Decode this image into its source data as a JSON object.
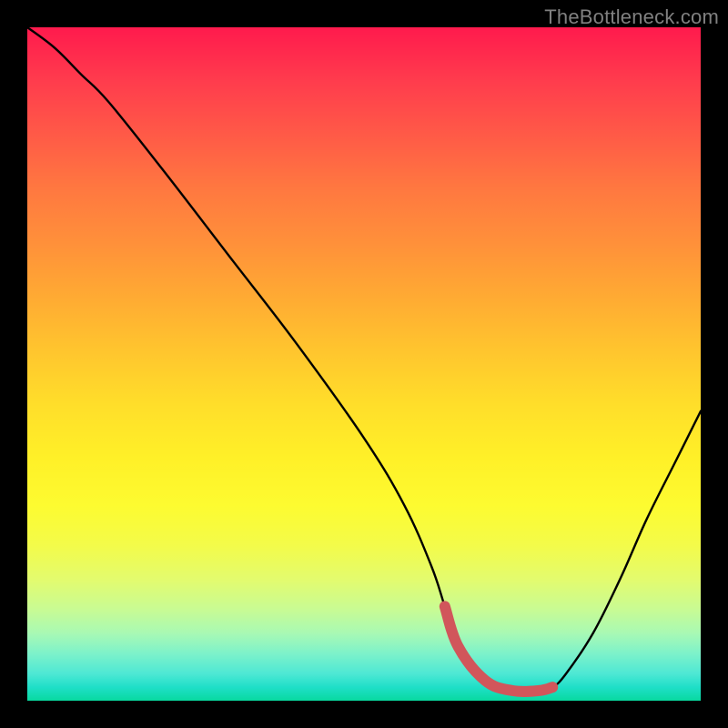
{
  "watermark": "TheBottleneck.com",
  "chart_data": {
    "type": "line",
    "title": "",
    "xlabel": "",
    "ylabel": "",
    "xlim": [
      0,
      100
    ],
    "ylim": [
      0,
      100
    ],
    "series": [
      {
        "name": "bottleneck-curve",
        "color": "#000000",
        "x": [
          0,
          4,
          8,
          12,
          20,
          30,
          40,
          50,
          56,
          60,
          62,
          64,
          68,
          72,
          76,
          78,
          80,
          84,
          88,
          92,
          96,
          100
        ],
        "values": [
          100,
          97,
          93,
          89,
          79,
          66,
          53,
          39,
          29,
          20,
          14,
          8,
          3,
          1.5,
          1.5,
          2,
          4,
          10,
          18,
          27,
          35,
          43
        ]
      },
      {
        "name": "bottleneck-optimal-range",
        "color": "#d1565b",
        "x": [
          62,
          64,
          68,
          72,
          76,
          78
        ],
        "values": [
          14,
          8,
          3,
          1.5,
          1.5,
          2
        ]
      }
    ]
  }
}
